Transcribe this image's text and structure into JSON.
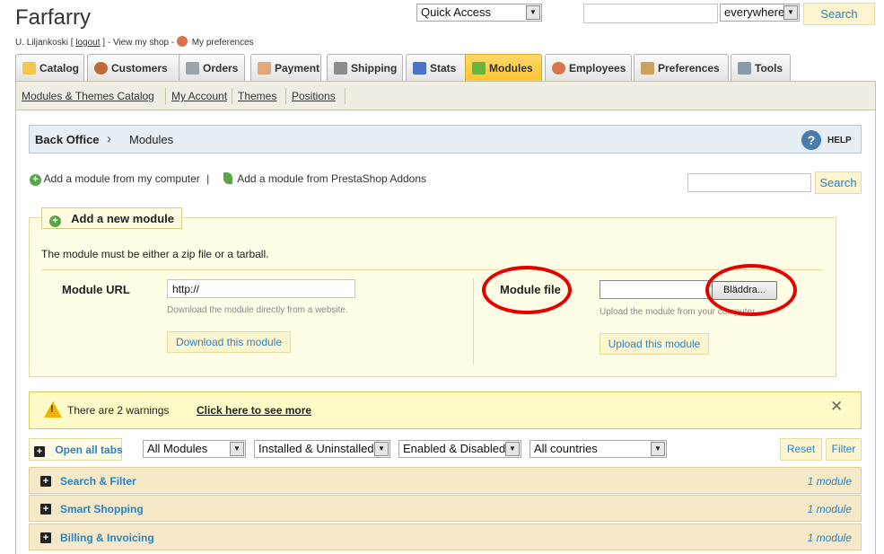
{
  "header": {
    "shop_name": "Farfarry",
    "user_name": "U. Liljankoski",
    "user_bracket_open": "[",
    "logout_label": "logout",
    "user_bracket_close": "]",
    "view_shop_label": "- View my shop -",
    "preferences_label": "My preferences",
    "quick_access": "Quick Access",
    "search_scope": "everywhere",
    "search_button": "Search",
    "search_value": ""
  },
  "tabs": [
    {
      "label": "Catalog",
      "icon": "folder-icon"
    },
    {
      "label": "Customers",
      "icon": "person-icon"
    },
    {
      "label": "Orders",
      "icon": "cart-icon"
    },
    {
      "label": "Payment",
      "icon": "payment-icon"
    },
    {
      "label": "Shipping",
      "icon": "truck-icon"
    },
    {
      "label": "Stats",
      "icon": "bar-chart-icon"
    },
    {
      "label": "Modules",
      "icon": "puzzle-icon",
      "active": true
    },
    {
      "label": "Employees",
      "icon": "employee-icon"
    },
    {
      "label": "Preferences",
      "icon": "settings-icon"
    },
    {
      "label": "Tools",
      "icon": "wrench-icon"
    }
  ],
  "subnav": [
    "Modules & Themes Catalog",
    "My Account",
    "Themes",
    "Positions"
  ],
  "breadcrumb": {
    "root": "Back Office",
    "current": "Modules",
    "help": "HELP"
  },
  "add_links": {
    "from_computer": "Add a module from my computer",
    "separator": "|",
    "from_addons": "Add a module from PrestaShop Addons"
  },
  "module_search": {
    "value": "",
    "button": "Search"
  },
  "add_module": {
    "legend": "Add a new module",
    "description": "The module must be either a zip file or a tarball.",
    "url_label": "Module URL",
    "url_value": "http://",
    "url_hint": "Download the module directly from a website.",
    "download_button": "Download this module",
    "file_label": "Module file",
    "browse_button": "Bläddra...",
    "file_hint": "Upload the module from your computer.",
    "upload_button": "Upload this module"
  },
  "warnings": {
    "text": "There are 2 warnings",
    "link": "Click here to see more",
    "close": "✕"
  },
  "filters": {
    "open_all": "Open all tabs",
    "modules": "All Modules",
    "installed": "Installed & Uninstalled",
    "enabled": "Enabled & Disabled",
    "countries": "All countries",
    "reset": "Reset",
    "filter": "Filter"
  },
  "categories": [
    {
      "name": "Search & Filter",
      "count": "1 module"
    },
    {
      "name": "Smart Shopping",
      "count": "1 module"
    },
    {
      "name": "Billing & Invoicing",
      "count": "1 module"
    }
  ],
  "colors": {
    "accent_blue": "#2a83c4",
    "active_tab": "#ffc533",
    "highlight_red": "#e50000"
  }
}
